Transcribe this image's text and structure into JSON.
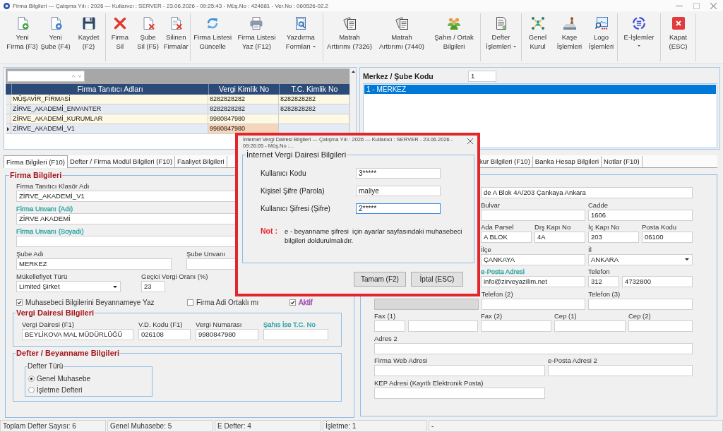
{
  "window": {
    "title": "Firma Bilgileri --- Çalışma Yılı : 2026 --- Kullanıcı : SERVER - 23.06.2026 - 09:25:43 - Müş.No : 424681 - Ver.No : 060526-02.2"
  },
  "toolbar": {
    "groups": [
      {
        "buttons": [
          {
            "lines": [
              "Yeni",
              "Firma (F3)"
            ],
            "dropdown": false
          },
          {
            "lines": [
              "Yeni",
              "Şube (F4)"
            ],
            "dropdown": false
          },
          {
            "lines": [
              "Kaydet",
              "(F2)"
            ],
            "dropdown": false
          }
        ]
      },
      {
        "buttons": [
          {
            "lines": [
              "Firma",
              "Sil"
            ],
            "dropdown": false
          },
          {
            "lines": [
              "Şube",
              "Sil (F5)"
            ],
            "dropdown": false
          },
          {
            "lines": [
              "Silinen",
              "Firmalar"
            ],
            "dropdown": false
          }
        ]
      },
      {
        "buttons": [
          {
            "lines": [
              "Firma Listesi",
              "Güncelle"
            ],
            "dropdown": false
          },
          {
            "lines": [
              "Firma Listesi",
              "Yaz (F12)"
            ],
            "dropdown": false
          },
          {
            "lines": [
              "Yazdırma",
              "Formları"
            ],
            "dropdown": true
          }
        ]
      },
      {
        "buttons": [
          {
            "lines": [
              "Matrah",
              "Arttırımı (7326)"
            ],
            "dropdown": false
          },
          {
            "lines": [
              "Matrah",
              "Arttırımı (7440)"
            ],
            "dropdown": false
          },
          {
            "lines": [
              "Şahıs / Ortak",
              "Bilgileri"
            ],
            "dropdown": false
          }
        ]
      },
      {
        "buttons": [
          {
            "lines": [
              "Defter",
              "İşlemleri"
            ],
            "dropdown": true
          }
        ]
      },
      {
        "buttons": [
          {
            "lines": [
              "Genel",
              "Kurul"
            ],
            "dropdown": false
          },
          {
            "lines": [
              "Kaşe",
              "İşlemleri"
            ],
            "dropdown": false
          },
          {
            "lines": [
              "Logo",
              "İşlemleri"
            ],
            "dropdown": false
          }
        ]
      },
      {
        "buttons": [
          {
            "lines": [
              "E-İşlemler"
            ],
            "dropdown": true
          }
        ]
      },
      {
        "buttons": [
          {
            "lines": [
              "Kapat",
              "(ESC)"
            ],
            "dropdown": false
          }
        ]
      }
    ]
  },
  "company_table": {
    "columns": [
      "Firma Tanıtıcı Adları",
      "Vergi Kimlik No",
      "T.C. Kimlik No"
    ],
    "rows": [
      {
        "firma_tanitici_adi": "MÜŞAVİR_FİRMASİ",
        "vergi_kimlik_no": "8282828282",
        "tc_kimlik_no": "8282828282",
        "selected": false
      },
      {
        "firma_tanitici_adi": "ZİRVE_AKADEMİ_ENVANTER",
        "vergi_kimlik_no": "8282828282",
        "tc_kimlik_no": "8282828282",
        "selected": false
      },
      {
        "firma_tanitici_adi": "ZİRVE_AKADEMİ_KURUMLAR",
        "vergi_kimlik_no": "9980847980",
        "selected": false
      },
      {
        "firma_tanitici_adi": "ZİRVE_AKADEMİ_V1",
        "vergi_kimlik_no": "9980847980",
        "selected": true
      }
    ]
  },
  "branch_panel": {
    "label": "Merkez / Şube Kodu",
    "code": "1",
    "items": [
      {
        "label": "1 - MERKEZ",
        "selected": true
      }
    ]
  },
  "tabs": [
    {
      "label": "Firma Bilgileri (F10)",
      "selected": true
    },
    {
      "label": "Defter / Firma Modül Bilgileri (F10)",
      "selected": false
    },
    {
      "label": "Faaliyet Bilgileri",
      "selected": false
    },
    {
      "label": "kur Bilgileri (F10)",
      "selected": false
    },
    {
      "label": "Banka Hesap Bilgileri",
      "selected": false
    },
    {
      "label": "Notlar (F10)",
      "selected": false
    }
  ],
  "firma_bilgileri": {
    "title": "Firma Bilgileri",
    "rows": [
      {
        "fields": [
          {
            "label": "Firma Tanıtıcı Klasör Adı",
            "kind": "text",
            "value": "ZİRVE_AKADEMİ_V1"
          }
        ]
      },
      {
        "fields": [
          {
            "label": "Firma Unvanı (Adı)",
            "color": "#35a6a6",
            "kind": "text",
            "value": "ZİRVE AKADEMİ"
          }
        ]
      },
      {
        "fields": [
          {
            "label": "Firma Unvanı (Soyadı)",
            "color": "#35a6a6",
            "kind": "text"
          }
        ]
      },
      {
        "fields": [
          {
            "label": "Şube Adı",
            "kind": "text",
            "value": "MERKEZ"
          },
          {
            "label": "Şube Unvanı",
            "kind": "text"
          }
        ]
      },
      {
        "fields": [
          {
            "label": "Mükellefiyet Türü",
            "kind": "dropdown",
            "value": "Limited Şirket"
          },
          {
            "label": "Geçici Vergi Oranı (%)",
            "kind": "text",
            "value": "23"
          }
        ]
      }
    ],
    "checkboxes": [
      {
        "label": "Muhasebeci Bilgilerini Beyannameye Yaz",
        "checked": true
      },
      {
        "label": "Firma Adi Ortaklı mı",
        "checked": false
      },
      {
        "label": "Aktif",
        "checked": true,
        "color": "#9b44b0"
      }
    ],
    "vergi_dairesi": {
      "title": "Vergi Dairesi Bilgileri",
      "fields": [
        {
          "label": "Vergi Dairesi (F1)",
          "kind": "text",
          "value": "BEYLİKOVA MAL MÜDÜRLÜĞÜ"
        },
        {
          "label": "V.D. Kodu (F1)",
          "kind": "text",
          "value": "026108"
        },
        {
          "label": "Vergi Numarası",
          "kind": "text",
          "value": "9980847980"
        },
        {
          "label": "Şahıs İse T.C. No",
          "color": "#35a6a6",
          "kind": "text"
        }
      ]
    },
    "defter_beyanname": {
      "title": "Defter / Beyanname Bilgileri",
      "defter_turu": {
        "title": "Defter Türü",
        "options": [
          {
            "label": "Genel Muhasebe",
            "selected": true
          },
          {
            "label": "İşletme Defteri",
            "selected": false
          }
        ]
      }
    }
  },
  "address_panel": {
    "rows": [
      {
        "fields": [
          {
            "kind": "text",
            "value": "de A Blok 4A/203 Çankaya Ankara",
            "disabled": false
          }
        ]
      },
      {
        "fields": [
          {
            "label": "Bulvar",
            "kind": "text",
            "disabled": false
          },
          {
            "label": "Cadde",
            "kind": "text",
            "value": "1606",
            "disabled": false
          }
        ]
      },
      {
        "fields": [
          {
            "label": "Ada Parsel",
            "kind": "text",
            "value": "A BLOK",
            "disabled": false
          },
          {
            "label": "Dış Kapı No",
            "kind": "text",
            "value": "4A",
            "disabled": false
          },
          {
            "label": "İç Kapı No",
            "kind": "text",
            "value": "203",
            "disabled": false
          },
          {
            "label": "Posta Kodu",
            "kind": "text",
            "value": "06100",
            "disabled": false
          }
        ]
      },
      {
        "fields": [
          {
            "label": "İlçe",
            "kind": "text",
            "value": "ÇANKAYA",
            "disabled": false
          },
          {
            "label": "İl",
            "kind": "dropdown",
            "value": "ANKARA",
            "disabled": false
          }
        ]
      },
      {
        "fields": [
          {
            "label": "e-Posta Adresi",
            "color": "#35a6a6",
            "kind": "text",
            "value": "info@zirveyazilim.net",
            "disabled": false
          },
          {
            "label": "Telefon",
            "kind": "split",
            "values": [
              "312",
              "4732800"
            ],
            "disabled": false
          }
        ]
      },
      {
        "fields": [
          {
            "kind": "text",
            "disabled": true
          },
          {
            "label": "Telefon (2)",
            "kind": "text",
            "disabled": false
          },
          {
            "label": "Telefon (3)",
            "kind": "text",
            "disabled": false
          }
        ]
      },
      {
        "fields": [
          {
            "label": "Fax (1)",
            "kind": "split",
            "disabled": false
          },
          {
            "label": "Fax (2)",
            "kind": "text",
            "disabled": false
          },
          {
            "label": "Cep (1)",
            "kind": "text",
            "disabled": false
          },
          {
            "label": "Cep (2)",
            "kind": "text",
            "disabled": false
          }
        ]
      },
      {
        "fields": [
          {
            "label": "Adres 2",
            "kind": "text",
            "disabled": false
          }
        ]
      },
      {
        "fields": [
          {
            "label": "Firma Web Adresi",
            "kind": "text",
            "disabled": false
          },
          {
            "label": "e-Posta Adresi 2",
            "kind": "text",
            "disabled": false
          }
        ]
      },
      {
        "fields": [
          {
            "label": "KEP Adresi (Kayıtlı Elektronik Posta)",
            "kind": "text",
            "disabled": false
          }
        ]
      }
    ]
  },
  "dialog": {
    "title": "İnternet Vergi Dairesi Bilgileri --- Çalışma Yılı : 2026 --- Kullanıcı : SERVER - 23.06.2026 - 09:26:05 - Müş.No :...",
    "group_title": "İnternet Vergi Dairesi Bilgileri",
    "fields": [
      {
        "label": "Kullanıcı Kodu",
        "value": "3*****",
        "focused": false
      },
      {
        "label": "Kişisel Şifre (Parola)",
        "value": "maliye",
        "focused": false
      },
      {
        "label": "Kullanıcı Şifresi (Şifre)",
        "value": "2*****",
        "focused": true
      }
    ],
    "note_label": "Not :",
    "note": "e - beyanname şifresi  için ayarlar sayfasındaki muhasebeci bilgileri doldurulmalıdır.",
    "buttons": [
      "Tamam (F2)",
      "İptal (ESC)"
    ]
  },
  "status_bar": [
    "Toplam Defter Sayısı: 6",
    "Genel Muhasebe: 5",
    "E Defter: 4",
    "İşletme: 1",
    "-"
  ]
}
